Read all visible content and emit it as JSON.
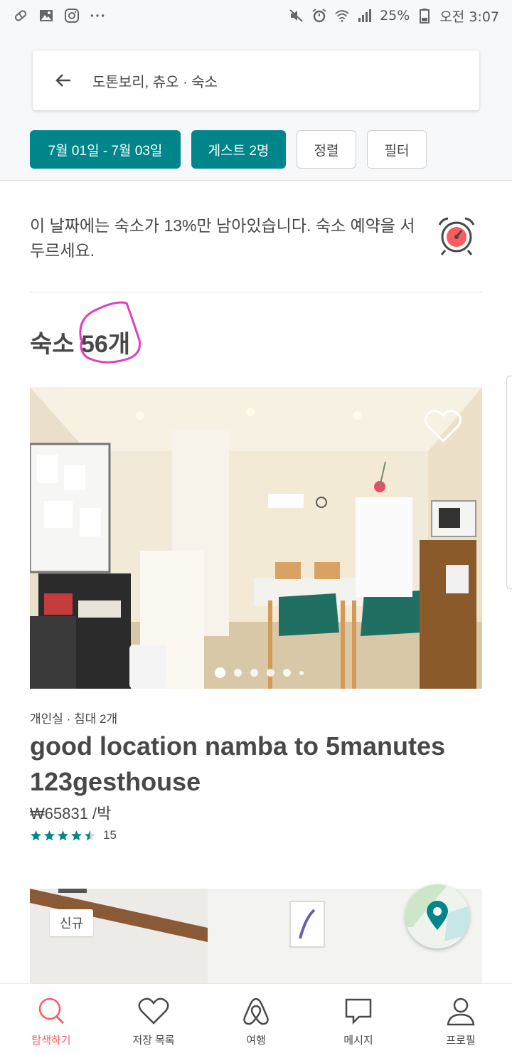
{
  "status_bar": {
    "battery": "25%",
    "time": "오전 3:07",
    "left_icons": [
      "pill-icon",
      "image-icon",
      "instagram-icon",
      "more-icon"
    ],
    "right_icons": [
      "mute-icon",
      "alarm-icon",
      "wifi-icon",
      "signal-icon",
      "battery-icon"
    ]
  },
  "search": {
    "location": "도톤보리, 츄오 · 숙소"
  },
  "filters": {
    "dates": "7월 01일 - 7월 03일",
    "guests": "게스트 2명",
    "sort": "정렬",
    "filter": "필터"
  },
  "colors": {
    "accent": "#00858a",
    "brand": "#ff5a5f",
    "annotation": "#e040c0"
  },
  "scarcity": {
    "message": "이 날짜에는 숙소가 13%만 남아있습니다. 숙소 예약을 서두르세요."
  },
  "results": {
    "label": "숙소 56개"
  },
  "listing": {
    "meta": "개인실 · 침대 2개",
    "title": "good location  namba to 5manutes 123gesthouse",
    "price": "₩65831 /박",
    "rating_stars": 4.5,
    "review_count": "15",
    "photo_count": 6,
    "active_photo": 1
  },
  "second_listing": {
    "badge": "신규"
  },
  "bottom_nav": {
    "items": [
      {
        "label": "탐색하기",
        "icon": "search-icon"
      },
      {
        "label": "저장 목록",
        "icon": "heart-icon"
      },
      {
        "label": "여행",
        "icon": "airbnb-logo-icon"
      },
      {
        "label": "메시지",
        "icon": "message-icon"
      },
      {
        "label": "프로필",
        "icon": "profile-icon"
      }
    ],
    "active": 0
  }
}
